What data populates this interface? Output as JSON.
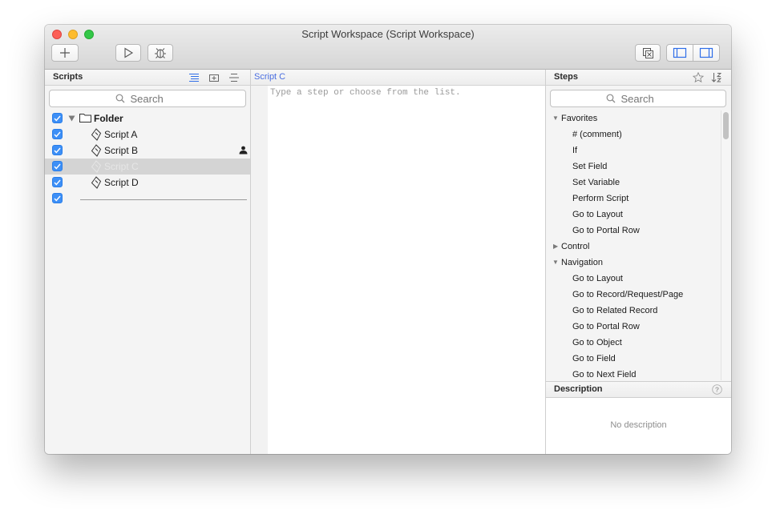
{
  "window": {
    "title": "Script Workspace (Script Workspace)"
  },
  "toolbar": {
    "icons": [
      "plus-icon",
      "play-icon",
      "bug-icon",
      "duplicate-window-icon",
      "left-pane-icon",
      "right-pane-icon"
    ]
  },
  "scripts_panel": {
    "title": "Scripts",
    "search_placeholder": "Search",
    "tree": [
      {
        "label": "Folder",
        "kind": "folder",
        "expanded": true
      },
      {
        "label": "Script A",
        "kind": "script"
      },
      {
        "label": "Script B",
        "kind": "script",
        "badge": "person-icon"
      },
      {
        "label": "Script C",
        "kind": "script",
        "selected": true
      },
      {
        "label": "Script D",
        "kind": "script"
      },
      {
        "label": "",
        "kind": "separator"
      }
    ]
  },
  "editor": {
    "tab_label": "Script C",
    "placeholder": "Type a step or choose from the list."
  },
  "steps_panel": {
    "title": "Steps",
    "search_placeholder": "Search",
    "groups": [
      {
        "label": "Favorites",
        "expanded": true,
        "items": [
          "# (comment)",
          "If",
          "Set Field",
          "Set Variable",
          "Perform Script",
          "Go to Layout",
          "Go to Portal Row"
        ]
      },
      {
        "label": "Control",
        "expanded": false,
        "items": []
      },
      {
        "label": "Navigation",
        "expanded": true,
        "items": [
          "Go to Layout",
          "Go to Record/Request/Page",
          "Go to Related Record",
          "Go to Portal Row",
          "Go to Object",
          "Go to Field",
          "Go to Next Field"
        ]
      }
    ]
  },
  "description": {
    "title": "Description",
    "text": "No description"
  },
  "colors": {
    "checkbox": "#3d8ff6",
    "selection": "#d4d4d4",
    "accent_text": "#4a6ee0"
  }
}
